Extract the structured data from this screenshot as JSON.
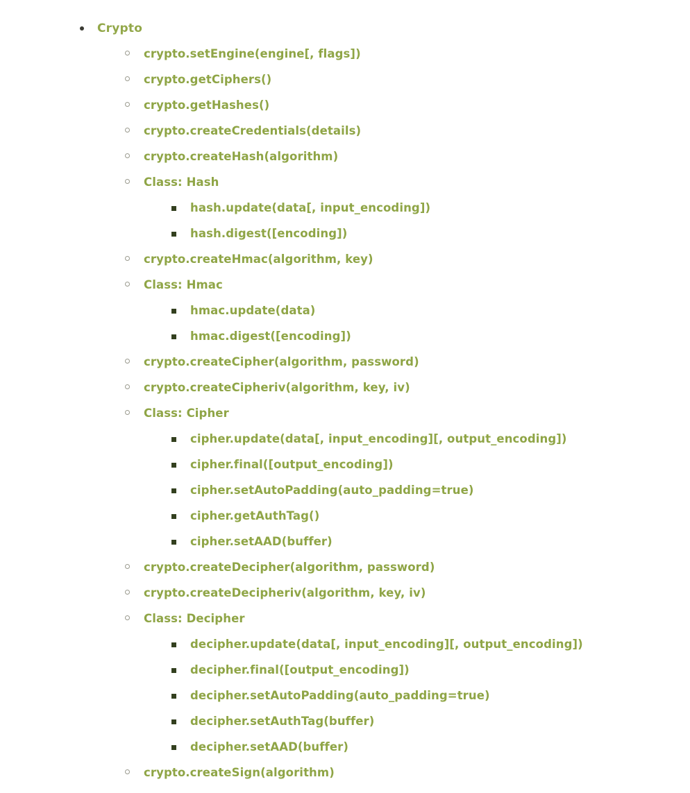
{
  "colors": {
    "link_green": "#8fa546",
    "top_level_green": "#93a84a",
    "disc_bullet": "#3a3a33",
    "ring_bullet": "#9a9a8e",
    "square_bullet": "#33401f",
    "background": "#ffffff"
  },
  "toc": {
    "root_label": "Crypto",
    "items": [
      {
        "label": "crypto.setEngine(engine[, flags])",
        "children": []
      },
      {
        "label": "crypto.getCiphers()",
        "children": []
      },
      {
        "label": "crypto.getHashes()",
        "children": []
      },
      {
        "label": "crypto.createCredentials(details)",
        "children": []
      },
      {
        "label": "crypto.createHash(algorithm)",
        "children": []
      },
      {
        "label": "Class: Hash",
        "children": [
          {
            "label": "hash.update(data[, input_encoding])"
          },
          {
            "label": "hash.digest([encoding])"
          }
        ]
      },
      {
        "label": "crypto.createHmac(algorithm, key)",
        "children": []
      },
      {
        "label": "Class: Hmac",
        "children": [
          {
            "label": "hmac.update(data)"
          },
          {
            "label": "hmac.digest([encoding])"
          }
        ]
      },
      {
        "label": "crypto.createCipher(algorithm, password)",
        "children": []
      },
      {
        "label": "crypto.createCipheriv(algorithm, key, iv)",
        "children": []
      },
      {
        "label": "Class: Cipher",
        "children": [
          {
            "label": "cipher.update(data[, input_encoding][, output_encoding])"
          },
          {
            "label": "cipher.final([output_encoding])"
          },
          {
            "label": "cipher.setAutoPadding(auto_padding=true)"
          },
          {
            "label": "cipher.getAuthTag()"
          },
          {
            "label": "cipher.setAAD(buffer)"
          }
        ]
      },
      {
        "label": "crypto.createDecipher(algorithm, password)",
        "children": []
      },
      {
        "label": "crypto.createDecipheriv(algorithm, key, iv)",
        "children": []
      },
      {
        "label": "Class: Decipher",
        "children": [
          {
            "label": "decipher.update(data[, input_encoding][, output_encoding])"
          },
          {
            "label": "decipher.final([output_encoding])"
          },
          {
            "label": "decipher.setAutoPadding(auto_padding=true)"
          },
          {
            "label": "decipher.setAuthTag(buffer)"
          },
          {
            "label": "decipher.setAAD(buffer)"
          }
        ]
      },
      {
        "label": "crypto.createSign(algorithm)",
        "children": []
      }
    ]
  }
}
